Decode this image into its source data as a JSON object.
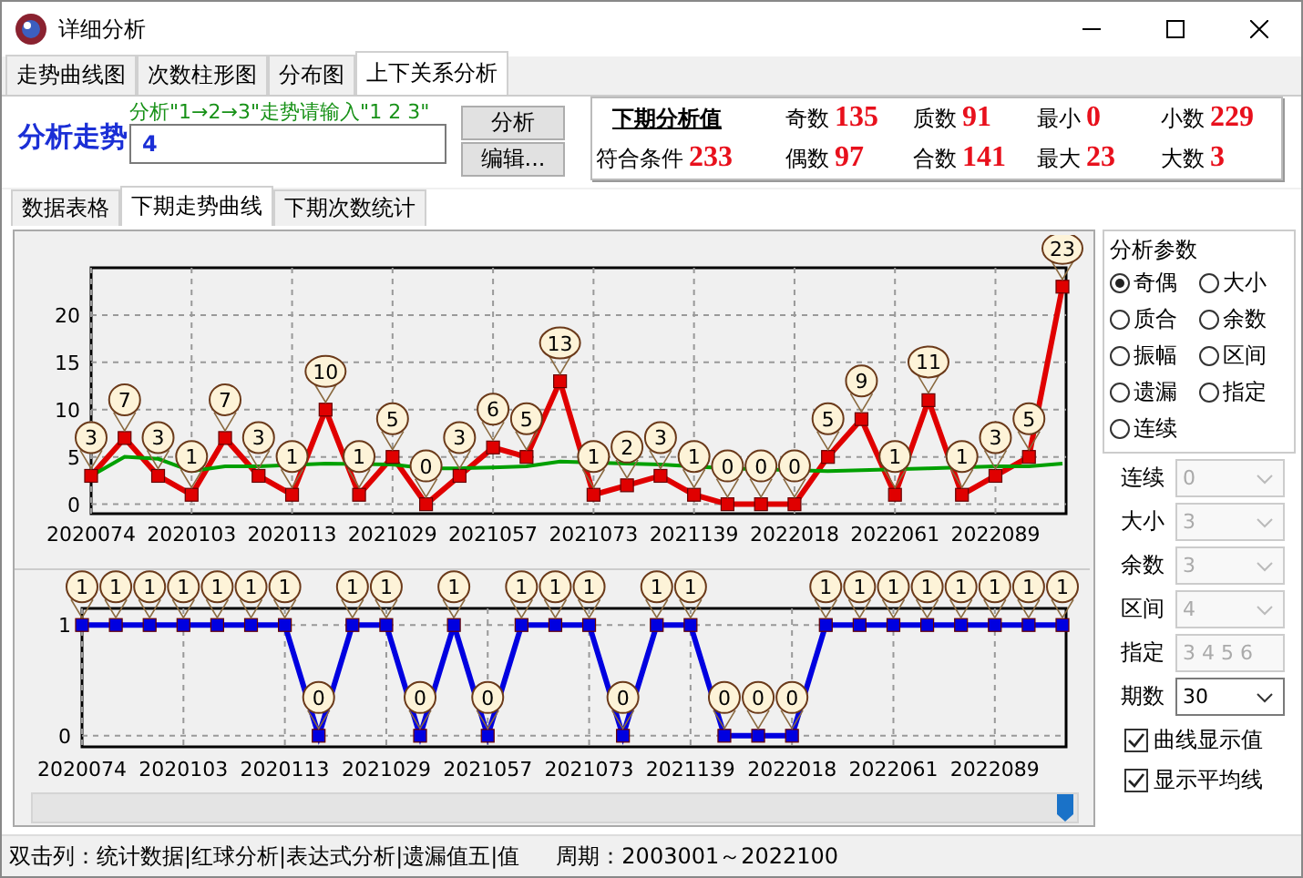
{
  "window": {
    "title": "详细分析"
  },
  "tabs": [
    {
      "label": "走势曲线图",
      "selected": false
    },
    {
      "label": "次数柱形图",
      "selected": false
    },
    {
      "label": "分布图",
      "selected": false
    },
    {
      "label": "上下关系分析",
      "selected": true
    }
  ],
  "analysis": {
    "title": "分析走势",
    "hint": "分析\"1→2→3\"走势请输入\"1 2 3\"",
    "value": "4",
    "buttons": [
      "分析",
      "编辑..."
    ]
  },
  "summary": {
    "heading": "下期分析值",
    "stats": [
      {
        "label": "奇数",
        "value": "135"
      },
      {
        "label": "质数",
        "value": "91"
      },
      {
        "label": "最小",
        "value": "0"
      },
      {
        "label": "小数",
        "value": "229"
      },
      {
        "label": "符合条件",
        "value": "233"
      },
      {
        "label": "偶数",
        "value": "97"
      },
      {
        "label": "合数",
        "value": "141"
      },
      {
        "label": "最大",
        "value": "23"
      },
      {
        "label": "大数",
        "value": "3"
      }
    ]
  },
  "subtabs": [
    {
      "label": "数据表格",
      "selected": false
    },
    {
      "label": "下期走势曲线",
      "selected": true
    },
    {
      "label": "下期次数统计",
      "selected": false
    }
  ],
  "charts": [
    {
      "chart_data": {
        "type": "line",
        "grid": true,
        "ylim": [
          -1,
          25
        ],
        "yticks": [
          0,
          5,
          10,
          15,
          20
        ],
        "categories": [
          "2020074",
          null,
          null,
          "2020103",
          null,
          null,
          "2020113",
          null,
          null,
          "2021029",
          null,
          null,
          "2021057",
          null,
          null,
          "2021073",
          null,
          null,
          "2021139",
          null,
          null,
          "2022018",
          null,
          null,
          "2022061",
          null,
          null,
          "2022089",
          null,
          null
        ],
        "series": [
          {
            "color": "#e00000",
            "marker": "square",
            "value_labels": [
              "3",
              "7",
              "3",
              "1",
              "7",
              "3",
              "1",
              "10",
              "1",
              "5",
              "0",
              "3",
              "6",
              "5",
              "13",
              "1",
              "2",
              "3",
              "1",
              "0",
              "0",
              "0",
              "5",
              "9",
              "1",
              "11",
              "1",
              "3",
              "5",
              "23"
            ],
            "values": [
              3,
              7,
              3,
              1,
              7,
              3,
              1,
              10,
              1,
              5,
              0,
              3,
              6,
              5,
              13,
              1,
              2,
              3,
              1,
              0,
              0,
              0,
              5,
              9,
              1,
              11,
              1,
              3,
              5,
              23
            ]
          },
          {
            "color": "#00a000",
            "values": [
              3,
              5,
              4.8,
              3.5,
              4,
              4,
              null,
              4.3,
              null,
              4.2,
              3.8,
              3.8,
              3.9,
              4,
              4.5,
              null,
              4.3,
              4.2,
              null,
              3.8,
              null,
              null,
              3.5,
              3.6,
              null,
              3.8,
              null,
              4,
              4,
              4.3
            ]
          }
        ]
      }
    },
    {
      "chart_data": {
        "type": "line",
        "grid": true,
        "ylim": [
          -0.1,
          1.15
        ],
        "yticks": [
          0,
          1
        ],
        "categories": [
          "2020074",
          null,
          null,
          "2020103",
          null,
          null,
          "2020113",
          null,
          null,
          "2021029",
          null,
          null,
          "2021057",
          null,
          null,
          "2021073",
          null,
          null,
          "2021139",
          null,
          null,
          "2022018",
          null,
          null,
          "2022061",
          null,
          null,
          "2022089",
          null,
          null
        ],
        "series": [
          {
            "color": "#0000e0",
            "marker": "square",
            "value_labels": [
              "1",
              "1",
              "1",
              "1",
              "1",
              "1",
              "1",
              "0",
              "1",
              "1",
              "0",
              "1",
              "0",
              "1",
              "1",
              "1",
              "0",
              "1",
              "1",
              "0",
              "0",
              "0",
              "1",
              "1",
              "1",
              "1",
              "1",
              "1",
              "1",
              "1"
            ],
            "values": [
              1,
              1,
              1,
              1,
              1,
              1,
              1,
              0,
              1,
              1,
              0,
              1,
              0,
              1,
              1,
              1,
              0,
              1,
              1,
              0,
              0,
              0,
              1,
              1,
              1,
              1,
              1,
              1,
              1,
              1
            ]
          }
        ]
      }
    }
  ],
  "params": {
    "title": "分析参数",
    "options": [
      {
        "label": "奇偶",
        "selected": true
      },
      {
        "label": "大小",
        "selected": false
      },
      {
        "label": "质合",
        "selected": false
      },
      {
        "label": "余数",
        "selected": false
      },
      {
        "label": "振幅",
        "selected": false
      },
      {
        "label": "区间",
        "selected": false
      },
      {
        "label": "遗漏",
        "selected": false
      },
      {
        "label": "指定",
        "selected": false
      },
      {
        "label": "连续",
        "selected": false
      }
    ],
    "fields": [
      {
        "label": "连续",
        "kind": "combo",
        "value": "0",
        "disabled": true
      },
      {
        "label": "大小",
        "kind": "combo",
        "value": "3",
        "disabled": true
      },
      {
        "label": "余数",
        "kind": "combo",
        "value": "3",
        "disabled": true
      },
      {
        "label": "区间",
        "kind": "combo",
        "value": "4",
        "disabled": true
      },
      {
        "label": "指定",
        "kind": "text",
        "value": "3 4 5 6",
        "disabled": true
      },
      {
        "label": "期数",
        "kind": "combo",
        "value": "30",
        "disabled": false
      }
    ],
    "checkboxes": [
      {
        "label": "曲线显示值",
        "checked": true
      },
      {
        "label": "显示平均线",
        "checked": true
      }
    ]
  },
  "status_bar": [
    "双击列：统计数据|红球分析|表达式分析|遗漏值五|值",
    "周期：2003001～2022100"
  ]
}
